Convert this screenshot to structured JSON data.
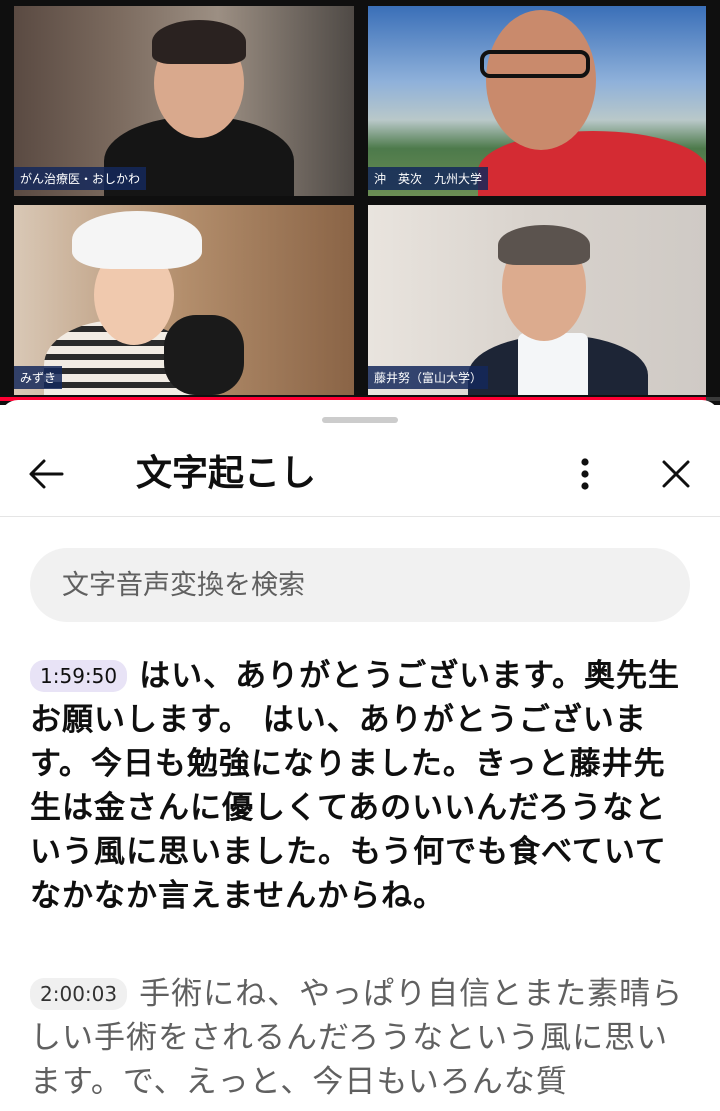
{
  "video": {
    "participants": [
      {
        "name": "がん治療医・おしかわ"
      },
      {
        "name": "沖　英次　九州大学"
      },
      {
        "name": "みずき"
      },
      {
        "name": "藤井努（富山大学）"
      }
    ],
    "progress_fraction": 0.98,
    "accent_color": "#ff0033"
  },
  "panel": {
    "title": "文字起こし",
    "back_icon": "arrow-left-icon",
    "more_icon": "more-vert-icon",
    "close_icon": "close-icon",
    "search_placeholder": "文字音声変換を検索"
  },
  "transcript": [
    {
      "timestamp": "1:59:50",
      "text": "はい、ありがとうございます。奥先生お願いします。 はい、ありがとうございます。今日も勉強になりました。きっと藤井先生は金さんに優しくてあのいいんだろうなという風に思いました。もう何でも食べていてなかなか言えませんからね。",
      "active": true
    },
    {
      "timestamp": "2:00:03",
      "text": "手術にね、やっぱり自信とまた素晴らしい手術をされるんだろうなという風に思います。で、えっと、今日もいろんな質",
      "active": false
    }
  ]
}
